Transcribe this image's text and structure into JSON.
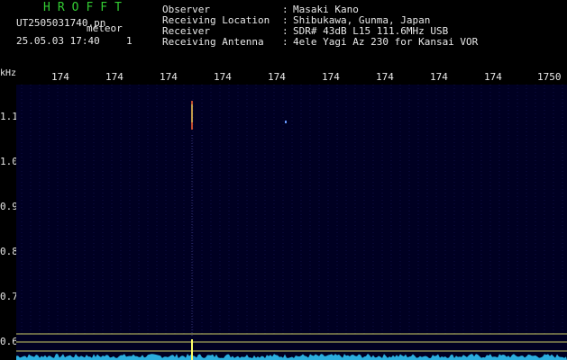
{
  "app_title": "HROFFT",
  "file": {
    "name": "UT2505031740.pn",
    "timestamp": "25.05.03 17:40",
    "event_type": "meteor",
    "count": "1"
  },
  "meta": [
    {
      "label": "Observer",
      "separator": ":",
      "value": "Masaki Kano"
    },
    {
      "label": "Receiving Location",
      "separator": ":",
      "value": "Shibukawa, Gunma, Japan"
    },
    {
      "label": "Receiver",
      "separator": ":",
      "value": "SDR# 43dB L15 111.6MHz USB"
    },
    {
      "label": "Receiving Antenna",
      "separator": ":",
      "value": "4ele Yagi Az 230 for Kansai VOR"
    }
  ],
  "axis": {
    "unit": "kHz",
    "freq_ticks": [
      "174",
      "174",
      "174",
      "174",
      "174",
      "174",
      "174",
      "174",
      "174",
      "1750"
    ],
    "y_ticks": [
      "1.1",
      "1.0",
      "0.9",
      "0.8",
      "0.7",
      "0.6"
    ],
    "y_values": [
      1.1,
      1.0,
      0.9,
      0.8,
      0.7,
      0.6
    ]
  },
  "colors": {
    "background": "#000022",
    "grid_dot": "#1a1a66",
    "signal": "#ffff66",
    "signal_core": "#ff6633",
    "baseline_noise": "#33ccff",
    "reference_line": "#cccc66",
    "title": "#33cc33",
    "text": "#e8e8e8"
  }
}
